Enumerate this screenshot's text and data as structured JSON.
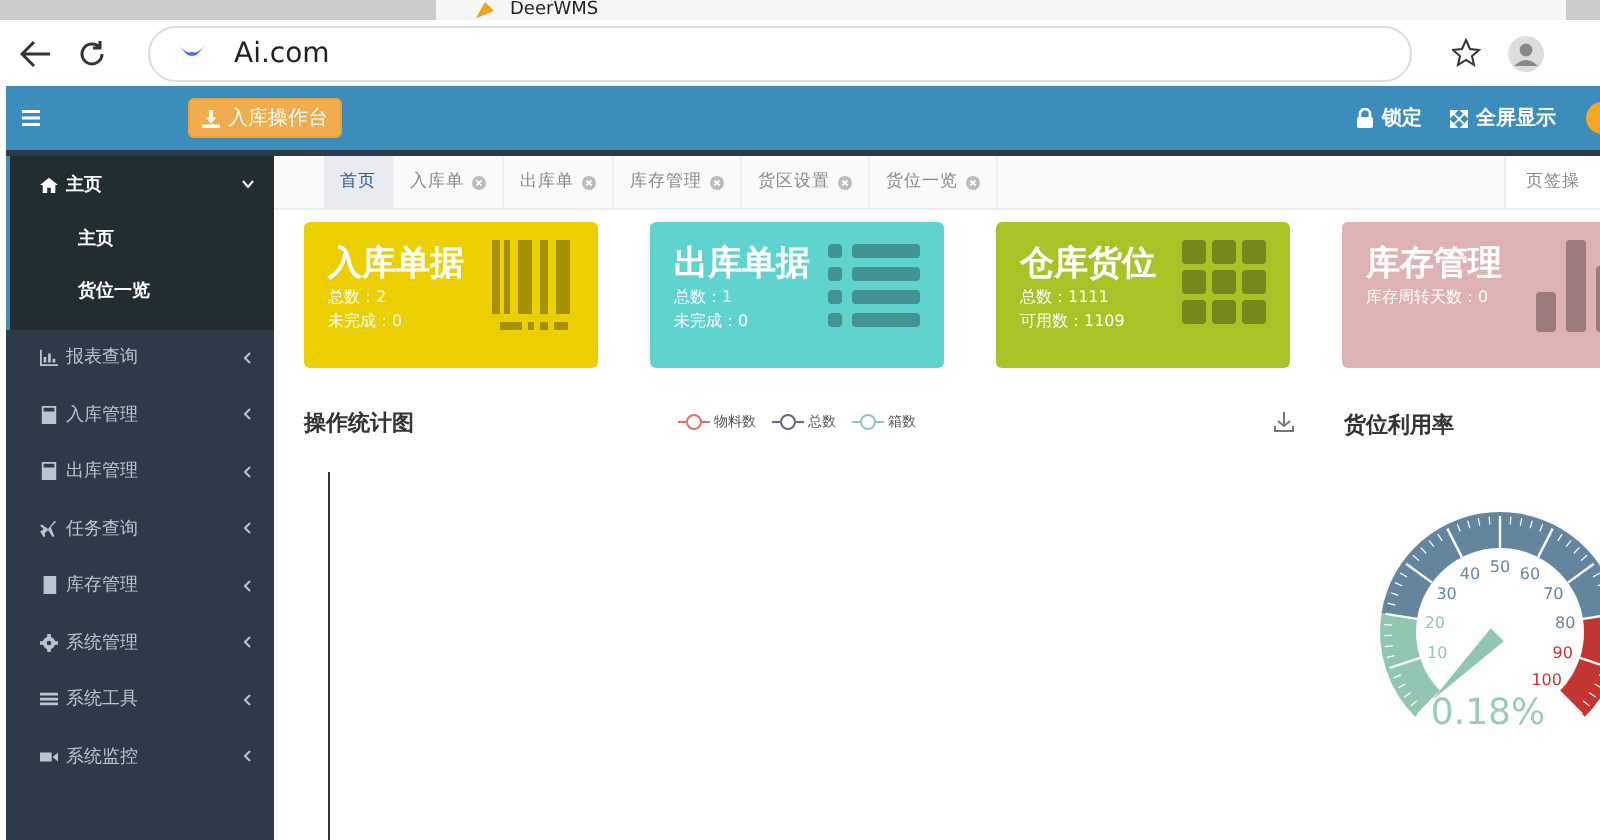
{
  "browser": {
    "tab_title": "DeerWMS",
    "address": "Ai.com"
  },
  "header": {
    "action_button": "入库操作台",
    "links": [
      {
        "kind": "lock",
        "label": "锁定"
      },
      {
        "kind": "fullscreen",
        "label": "全屏显示"
      }
    ]
  },
  "sidebar": {
    "items": [
      {
        "kind": "home",
        "label": "主页",
        "expanded": true,
        "children": [
          {
            "label": "主页"
          },
          {
            "label": "货位一览"
          }
        ]
      },
      {
        "kind": "chart",
        "label": "报表查询",
        "expanded": false
      },
      {
        "kind": "calc",
        "label": "入库管理",
        "expanded": false
      },
      {
        "kind": "calc",
        "label": "出库管理",
        "expanded": false
      },
      {
        "kind": "plane",
        "label": "任务查询",
        "expanded": false
      },
      {
        "kind": "book",
        "label": "库存管理",
        "expanded": false
      },
      {
        "kind": "gear",
        "label": "系统管理",
        "expanded": false
      },
      {
        "kind": "bars",
        "label": "系统工具",
        "expanded": false
      },
      {
        "kind": "video",
        "label": "系统监控",
        "expanded": false
      }
    ]
  },
  "tabs": {
    "items": [
      {
        "label": "首页",
        "selected": true,
        "closable": false
      },
      {
        "label": "入库单",
        "selected": false,
        "closable": true
      },
      {
        "label": "出库单",
        "selected": false,
        "closable": true
      },
      {
        "label": "库存管理",
        "selected": false,
        "closable": true
      },
      {
        "label": "货区设置",
        "selected": false,
        "closable": true
      },
      {
        "label": "货位一览",
        "selected": false,
        "closable": true
      }
    ],
    "menu": "页签操"
  },
  "cards": [
    {
      "kind": "barcode",
      "color": "#ebcf00",
      "title": "入库单据",
      "lines": [
        "总数：2",
        "未完成：0"
      ]
    },
    {
      "kind": "list",
      "color": "#5fd4cf",
      "title": "出库单据",
      "lines": [
        "总数：1",
        "未完成：0"
      ]
    },
    {
      "kind": "grid",
      "color": "#abc227",
      "title": "仓库货位",
      "lines": [
        "总数：1111",
        "可用数：1109"
      ]
    },
    {
      "kind": "bars",
      "color": "#deb1b2",
      "title": "库存管理",
      "lines": [
        "库存周转天数：0"
      ]
    }
  ],
  "operation_chart": {
    "title": "操作统计图",
    "legend": [
      {
        "label": "物料数",
        "color": "#e06c6c"
      },
      {
        "label": "总数",
        "color": "#5d6b80"
      },
      {
        "label": "箱数",
        "color": "#8ec5c9"
      }
    ]
  },
  "gauge": {
    "title": "货位利用率",
    "scale_labels": [
      "10",
      "20",
      "30",
      "40",
      "50",
      "60",
      "70",
      "80",
      "90",
      "100"
    ],
    "reading": "0.18%"
  }
}
